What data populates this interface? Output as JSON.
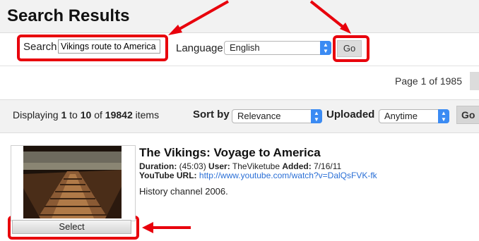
{
  "header": {
    "title": "Search Results"
  },
  "search": {
    "label": "Search",
    "value": "Vikings route to America",
    "language_label": "Language",
    "language_value": "English",
    "go_label": "Go"
  },
  "pagination": {
    "text": "Page 1 of 1985"
  },
  "results_bar": {
    "displaying_prefix": "Displaying ",
    "from": "1",
    "to_word": " to ",
    "to": "10",
    "of_word": " of ",
    "total": "19842",
    "items_suffix": " items",
    "sort_label": "Sort by",
    "sort_value": "Relevance",
    "uploaded_label": "Uploaded",
    "uploaded_value": "Anytime",
    "go_label": "Go"
  },
  "results": [
    {
      "title": "The Vikings: Voyage to America",
      "duration_label": "Duration:",
      "duration": "(45:03)",
      "user_label": "User:",
      "user": "TheViketube",
      "added_label": "Added:",
      "added": "7/16/11",
      "youtube_label": "YouTube URL:",
      "youtube_url": "http://www.youtube.com/watch?v=DalQsFVK-fk",
      "description": "History channel 2006.",
      "select_label": "Select"
    }
  ],
  "colors": {
    "highlight": "#e8000c",
    "link": "#2a6fd6",
    "select_arrow_bg": "#3b8bf3"
  }
}
